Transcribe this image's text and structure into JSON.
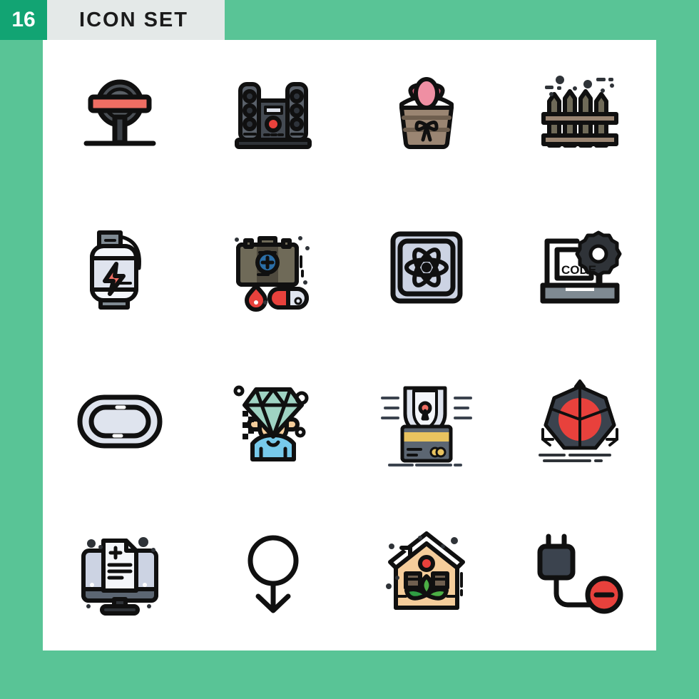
{
  "header": {
    "badge_count": "16",
    "title": "ICON SET",
    "badge_bg": "#12a473",
    "strip_bg": "#e4e9e8",
    "title_color": "#1b1b1b"
  },
  "canvas": {
    "bg": "#ffffff",
    "page_bg": "#59c496"
  },
  "palette": {
    "stroke": "#101010",
    "red": "#e8413c",
    "salmon": "#ef6e63",
    "pink": "#ef8fa3",
    "pink_dark": "#e0637f",
    "brown": "#9a8572",
    "brown_dark": "#6f5f4f",
    "olive": "#6f6a58",
    "lavender": "#ccd3e3",
    "lavender_light": "#dfe4ee",
    "slate": "#5c6672",
    "slate_dark": "#3b434e",
    "gray": "#7f8a92",
    "yellow": "#e9c35f",
    "green": "#4caf45",
    "green_dark": "#2f9e43",
    "mint": "#9fd3c3",
    "sky": "#77c9ea",
    "skin": "#f6cd9a",
    "peach": "#f5cd9b",
    "charcoal": "#2f3338"
  },
  "icons": [
    {
      "row": 1,
      "col": 1,
      "name": "road-sign-icon",
      "label": "Road sign on post"
    },
    {
      "row": 1,
      "col": 2,
      "name": "sound-system-icon",
      "label": "Hi-fi stereo sound system"
    },
    {
      "row": 1,
      "col": 3,
      "name": "easter-basket-icon",
      "label": "Easter basket with egg"
    },
    {
      "row": 1,
      "col": 4,
      "name": "picket-fence-icon",
      "label": "Wooden picket fence"
    },
    {
      "row": 2,
      "col": 1,
      "name": "gas-cylinder-icon",
      "label": "Energy gas cylinder"
    },
    {
      "row": 2,
      "col": 2,
      "name": "first-aid-kit-icon",
      "label": "First aid kit with pill and blood drop"
    },
    {
      "row": 2,
      "col": 3,
      "name": "atom-chip-icon",
      "label": "Atom on square chip"
    },
    {
      "row": 2,
      "col": 4,
      "name": "code-laptop-icon",
      "label": "Laptop with CODE and gear"
    },
    {
      "row": 3,
      "col": 1,
      "name": "race-track-icon",
      "label": "Running race track oval"
    },
    {
      "row": 3,
      "col": 2,
      "name": "diamond-person-icon",
      "label": "Person with diamond head"
    },
    {
      "row": 3,
      "col": 3,
      "name": "card-security-icon",
      "label": "Credit card shield security"
    },
    {
      "row": 3,
      "col": 4,
      "name": "3d-object-icon",
      "label": "3D object with axes"
    },
    {
      "row": 4,
      "col": 1,
      "name": "medical-record-icon",
      "label": "Monitor with medical record"
    },
    {
      "row": 4,
      "col": 2,
      "name": "gender-arrow-icon",
      "label": "Gender symbol with down arrow"
    },
    {
      "row": 4,
      "col": 3,
      "name": "eco-house-icon",
      "label": "Eco green house with leaves"
    },
    {
      "row": 4,
      "col": 4,
      "name": "plug-remove-icon",
      "label": "Power plug with remove badge"
    }
  ],
  "labels": {
    "code_text": "CODE"
  }
}
